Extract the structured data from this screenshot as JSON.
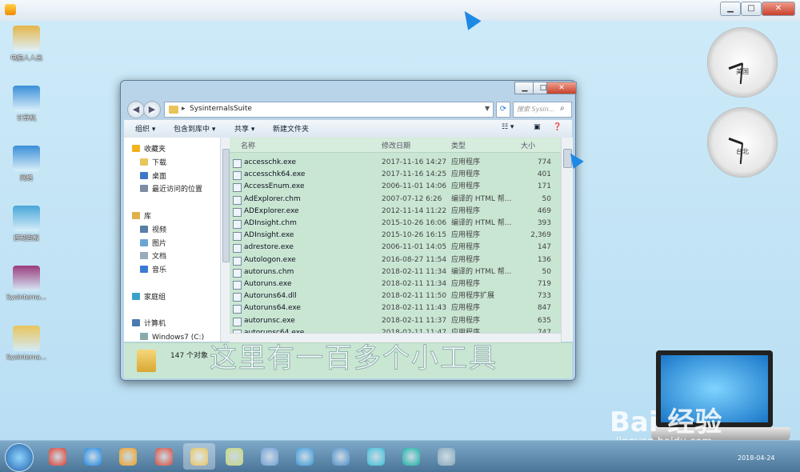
{
  "player": {
    "title": "",
    "close_label": "✕",
    "min_label": "▁",
    "max_label": "□"
  },
  "desktop": {
    "icons": [
      {
        "name": "电脑人人出",
        "kind": "user-folder",
        "color": "#e5b54a"
      },
      {
        "name": "计算机",
        "kind": "computer",
        "color": "#3a8fd8"
      },
      {
        "name": "网络",
        "kind": "network",
        "color": "#3a8fd8"
      },
      {
        "name": "控制面板",
        "kind": "control-panel",
        "color": "#48a6d8"
      },
      {
        "name": "Sysinterna...",
        "kind": "archive",
        "color": "#9b3b7c"
      },
      {
        "name": "Sysinterna...",
        "kind": "folder",
        "color": "#e9c45a"
      }
    ]
  },
  "explorer": {
    "path": "SysinternalsSuite",
    "search_placeholder": "搜索 Sysin...",
    "toolbar": {
      "organize": "组织 ▾",
      "include": "包含到库中 ▾",
      "share": "共享 ▾",
      "new_folder": "新建文件夹"
    },
    "nav": [
      {
        "label": "收藏夹",
        "indent": 0,
        "color": "#f2b21b"
      },
      {
        "label": "下载",
        "indent": 1,
        "color": "#e9c45a"
      },
      {
        "label": "桌面",
        "indent": 1,
        "color": "#3f78c6"
      },
      {
        "label": "最近访问的位置",
        "indent": 1,
        "color": "#7c8da3"
      },
      {
        "label": "",
        "indent": 0,
        "color": ""
      },
      {
        "label": "库",
        "indent": 0,
        "color": "#e0b04a"
      },
      {
        "label": "视频",
        "indent": 1,
        "color": "#5b7ea7"
      },
      {
        "label": "图片",
        "indent": 1,
        "color": "#6aa5d8"
      },
      {
        "label": "文档",
        "indent": 1,
        "color": "#9ab"
      },
      {
        "label": "音乐",
        "indent": 1,
        "color": "#3a7bd5"
      },
      {
        "label": "",
        "indent": 0,
        "color": ""
      },
      {
        "label": "家庭组",
        "indent": 0,
        "color": "#3aa0c8"
      },
      {
        "label": "",
        "indent": 0,
        "color": ""
      },
      {
        "label": "计算机",
        "indent": 0,
        "color": "#4a7bb0"
      },
      {
        "label": "Windows7 (C:)",
        "indent": 1,
        "color": "#8aa"
      }
    ],
    "columns": {
      "name": "名称",
      "date": "修改日期",
      "type": "类型",
      "size": "大小"
    },
    "files": [
      {
        "name": "accesschk.exe",
        "date": "2017-11-16 14:27",
        "type": "应用程序",
        "size": "774"
      },
      {
        "name": "accesschk64.exe",
        "date": "2017-11-16 14:25",
        "type": "应用程序",
        "size": "401"
      },
      {
        "name": "AccessEnum.exe",
        "date": "2006-11-01 14:06",
        "type": "应用程序",
        "size": "171"
      },
      {
        "name": "AdExplorer.chm",
        "date": "2007-07-12 6:26",
        "type": "编译的 HTML 帮...",
        "size": "50"
      },
      {
        "name": "ADExplorer.exe",
        "date": "2012-11-14 11:22",
        "type": "应用程序",
        "size": "469"
      },
      {
        "name": "ADInsight.chm",
        "date": "2015-10-26 16:06",
        "type": "编译的 HTML 帮...",
        "size": "393"
      },
      {
        "name": "ADInsight.exe",
        "date": "2015-10-26 16:15",
        "type": "应用程序",
        "size": "2,369"
      },
      {
        "name": "adrestore.exe",
        "date": "2006-11-01 14:05",
        "type": "应用程序",
        "size": "147"
      },
      {
        "name": "Autologon.exe",
        "date": "2016-08-27 11:54",
        "type": "应用程序",
        "size": "136"
      },
      {
        "name": "autoruns.chm",
        "date": "2018-02-11 11:34",
        "type": "编译的 HTML 帮...",
        "size": "50"
      },
      {
        "name": "Autoruns.exe",
        "date": "2018-02-11 11:34",
        "type": "应用程序",
        "size": "719"
      },
      {
        "name": "Autoruns64.dll",
        "date": "2018-02-11 11:50",
        "type": "应用程序扩展",
        "size": "733"
      },
      {
        "name": "Autoruns64.exe",
        "date": "2018-02-11 11:43",
        "type": "应用程序",
        "size": "847"
      },
      {
        "name": "autorunsc.exe",
        "date": "2018-02-11 11:37",
        "type": "应用程序",
        "size": "635"
      },
      {
        "name": "autorunsc64.exe",
        "date": "2018-02-11 11:47",
        "type": "应用程序",
        "size": "747"
      }
    ],
    "status_count": "147 个对象"
  },
  "overlay_caption": "这里有一百多个小工具",
  "clocks": [
    {
      "city": "美国"
    },
    {
      "city": "台北"
    }
  ],
  "watermark": {
    "brand": "Bai 经验",
    "url": "jingyan.baidu.com"
  },
  "taskbar": {
    "date": "2018-04-24",
    "items": [
      {
        "name": "jiang-app",
        "color": "#e23c2b"
      },
      {
        "name": "internet-explorer",
        "color": "#1e88e5"
      },
      {
        "name": "media-player",
        "color": "#f2a01c"
      },
      {
        "name": "chrome",
        "color": "#dd4b39"
      },
      {
        "name": "explorer",
        "color": "#e9c45a"
      },
      {
        "name": "folder",
        "color": "#c9d77a"
      },
      {
        "name": "document",
        "color": "#6f9fd6"
      },
      {
        "name": "browser-round",
        "color": "#3a9ad8"
      },
      {
        "name": "remote-desktop",
        "color": "#4f8fc8"
      },
      {
        "name": "pinwheel",
        "color": "#3ac0d8"
      },
      {
        "name": "headset",
        "color": "#17b3a3"
      },
      {
        "name": "paint",
        "color": "#8ab"
      }
    ]
  }
}
